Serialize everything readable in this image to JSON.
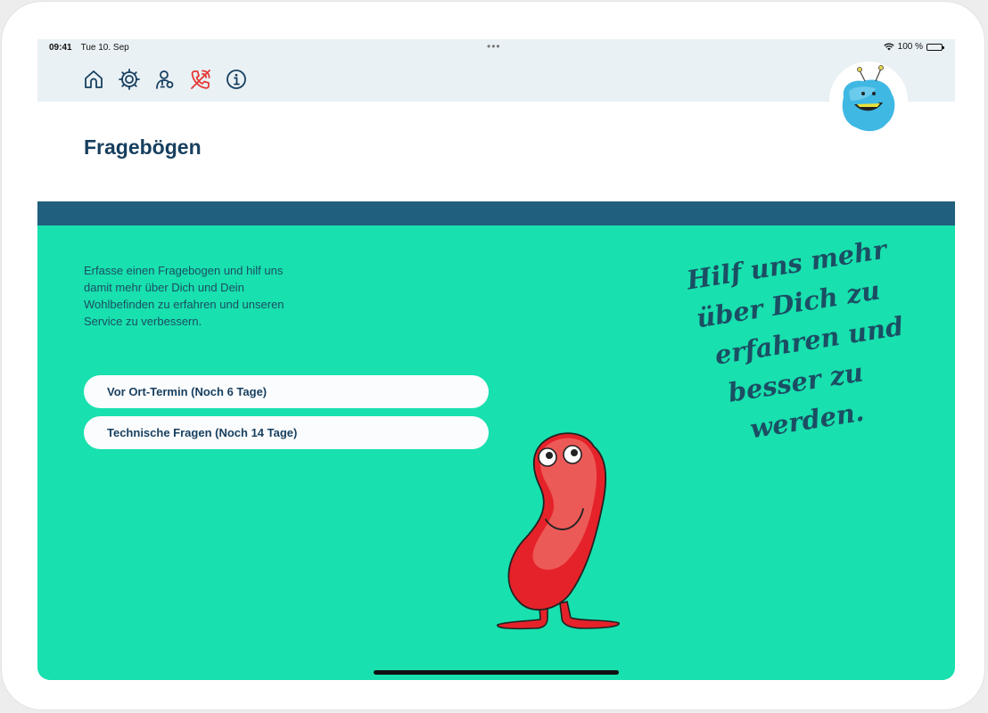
{
  "status": {
    "time": "09:41",
    "date": "Tue 10. Sep",
    "dots": "•••",
    "battery": "100 %"
  },
  "toolbar": {
    "icons": [
      "home-icon",
      "settings-gear-icon",
      "profile-icon",
      "emergency-phone-icon",
      "info-icon"
    ]
  },
  "page": {
    "title": "Fragebögen",
    "intro": "Erfasse einen Fragebogen und hilf uns damit mehr über Dich und Dein Wohlbefinden zu erfahren und unseren Service zu verbessern."
  },
  "questionnaires": [
    {
      "label": "Vor Ort-Termin (Noch 6 Tage)"
    },
    {
      "label": "Technische Fragen (Noch 14 Tage)"
    }
  ],
  "slogan": {
    "lines": [
      "Hilf uns mehr",
      "über Dich zu",
      "erfahren und",
      "besser zu",
      "werden."
    ]
  },
  "colors": {
    "accent_green": "#18e0ae",
    "band_blue": "#205f7e",
    "title_navy": "#173f5f",
    "alert_red": "#e53935",
    "toolbar_bg": "#e9f1f5"
  }
}
